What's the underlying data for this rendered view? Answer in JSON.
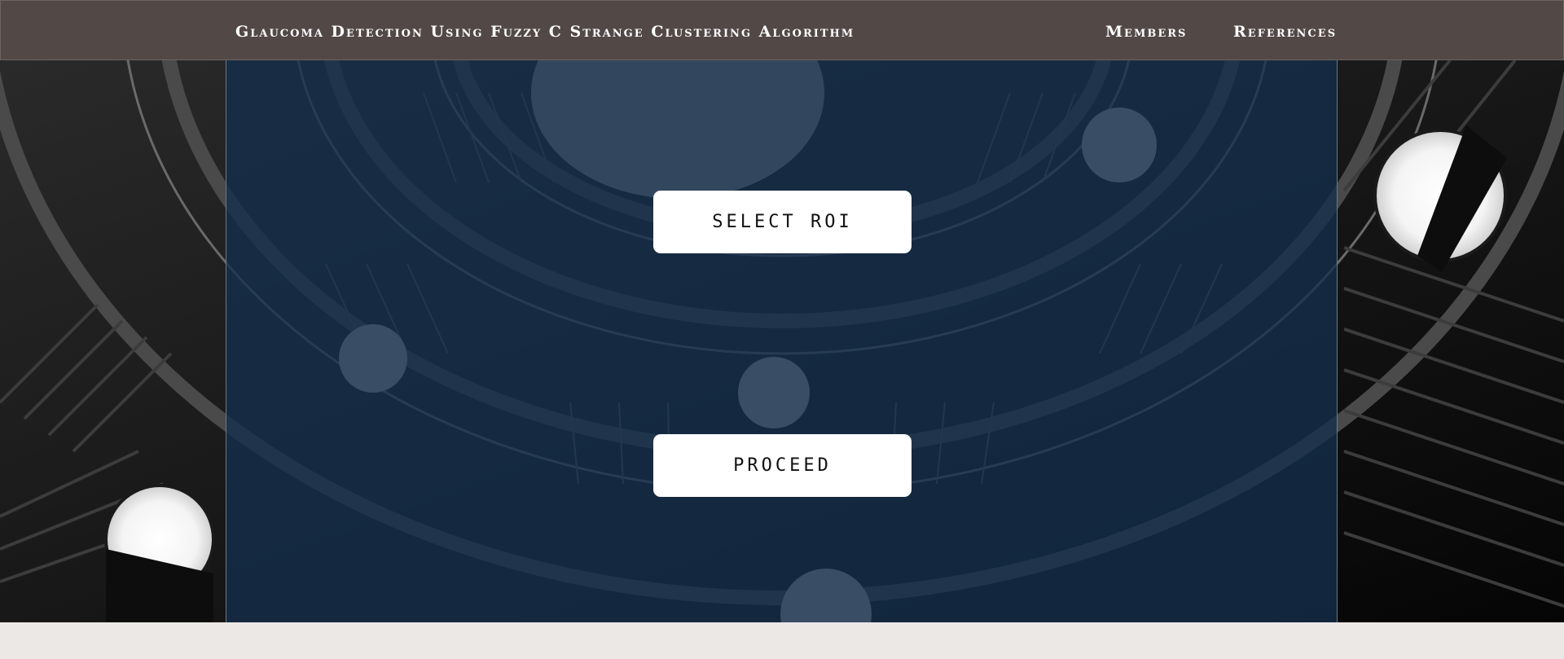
{
  "header": {
    "title": "Glaucoma Detection Using Fuzzy C Strange Clustering Algorithm",
    "nav": [
      {
        "label": "Members"
      },
      {
        "label": "References"
      }
    ]
  },
  "main": {
    "select_roi_label": "SELECT ROI",
    "proceed_label": "PROCEED"
  },
  "colors": {
    "header_bg": "#524845",
    "panel_overlay": "#15304d",
    "button_bg": "#ffffff",
    "page_bg": "#ece8e6"
  },
  "icons": {
    "background": "spiral-staircase-photo"
  }
}
